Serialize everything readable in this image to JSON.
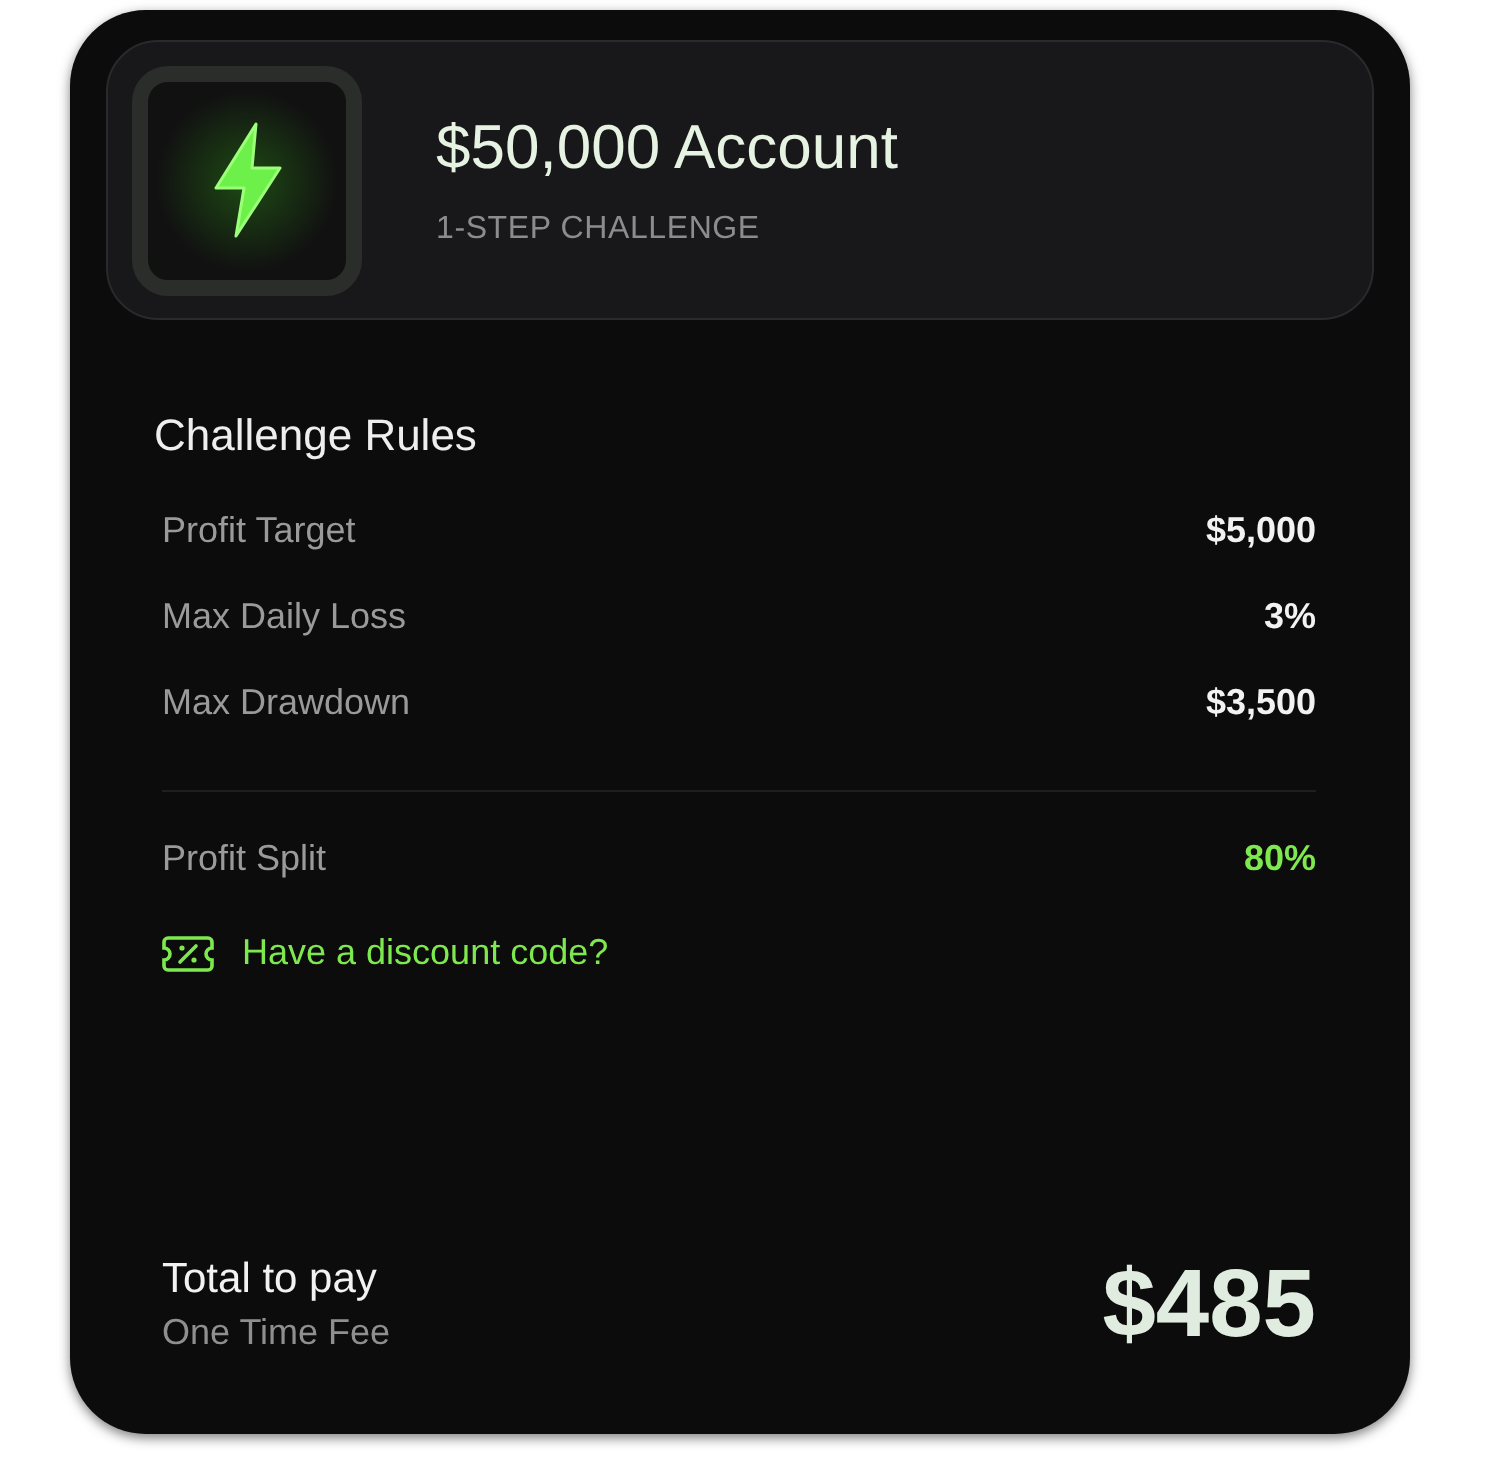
{
  "account": {
    "title": "$50,000 Account",
    "subtitle": "1-STEP CHALLENGE"
  },
  "rules": {
    "title": "Challenge Rules",
    "items": [
      {
        "label": "Profit Target",
        "value": "$5,000"
      },
      {
        "label": "Max Daily Loss",
        "value": "3%"
      },
      {
        "label": "Max Drawdown",
        "value": "$3,500"
      }
    ]
  },
  "profit_split": {
    "label": "Profit Split",
    "value": "80%"
  },
  "discount_link": "Have a discount code?",
  "total": {
    "label": "Total to pay",
    "note": "One Time Fee",
    "amount": "$485"
  }
}
